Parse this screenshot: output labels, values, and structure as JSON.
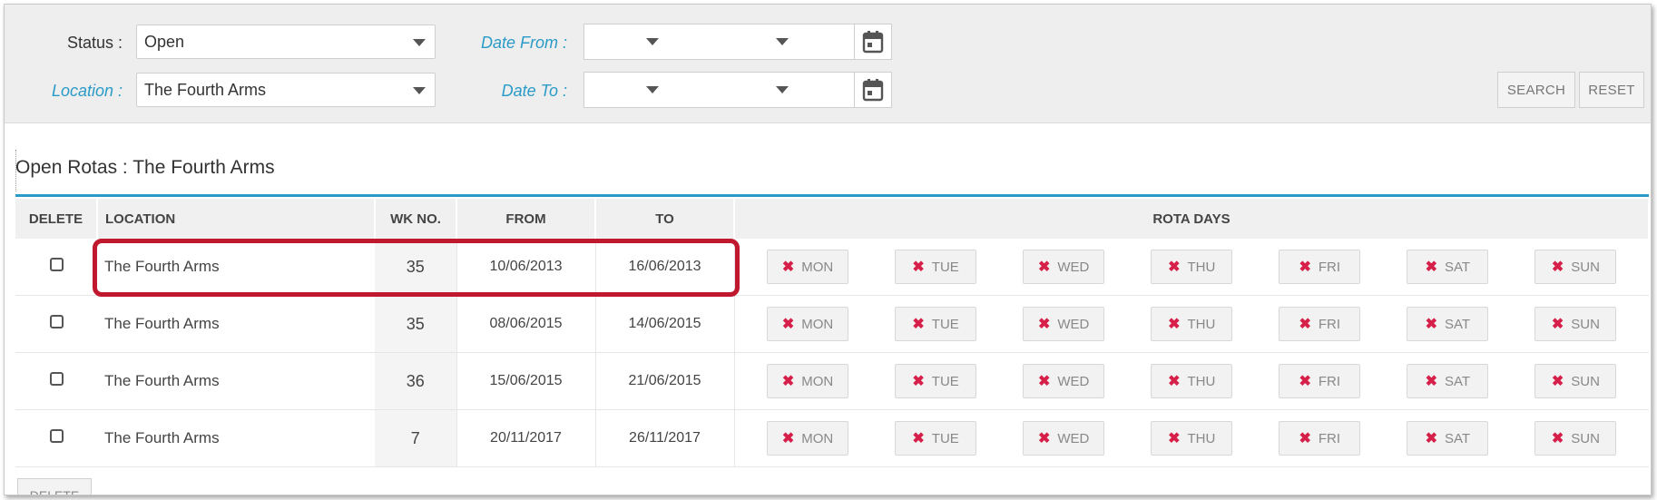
{
  "filters": {
    "status_label": "Status :",
    "status_value": "Open",
    "location_label": "Location :",
    "location_value": "The Fourth Arms",
    "date_from_label": "Date From :",
    "date_to_label": "Date To :",
    "search_label": "SEARCH",
    "reset_label": "RESET"
  },
  "section": {
    "title": "Open Rotas : The Fourth Arms"
  },
  "table": {
    "headers": {
      "delete": "DELETE",
      "location": "LOCATION",
      "wk": "WK NO.",
      "from": "FROM",
      "to": "TO",
      "rota_days": "ROTA DAYS"
    },
    "rows": [
      {
        "location": "The Fourth Arms",
        "wk": "35",
        "from": "10/06/2013",
        "to": "16/06/2013"
      },
      {
        "location": "The Fourth Arms",
        "wk": "35",
        "from": "08/06/2015",
        "to": "14/06/2015"
      },
      {
        "location": "The Fourth Arms",
        "wk": "36",
        "from": "15/06/2015",
        "to": "21/06/2015"
      },
      {
        "location": "The Fourth Arms",
        "wk": "7",
        "from": "20/11/2017",
        "to": "26/11/2017"
      }
    ],
    "days": [
      "MON",
      "TUE",
      "WED",
      "THU",
      "FRI",
      "SAT",
      "SUN"
    ]
  },
  "footer": {
    "delete_label": "DELETE"
  },
  "colors": {
    "accent": "#2a9bc7",
    "highlight": "#c0182e",
    "x_mark": "#d6204a"
  },
  "icons": {
    "calendar": "calendar-icon",
    "day_status": "close-icon",
    "dropdown": "chevron-down-icon"
  }
}
